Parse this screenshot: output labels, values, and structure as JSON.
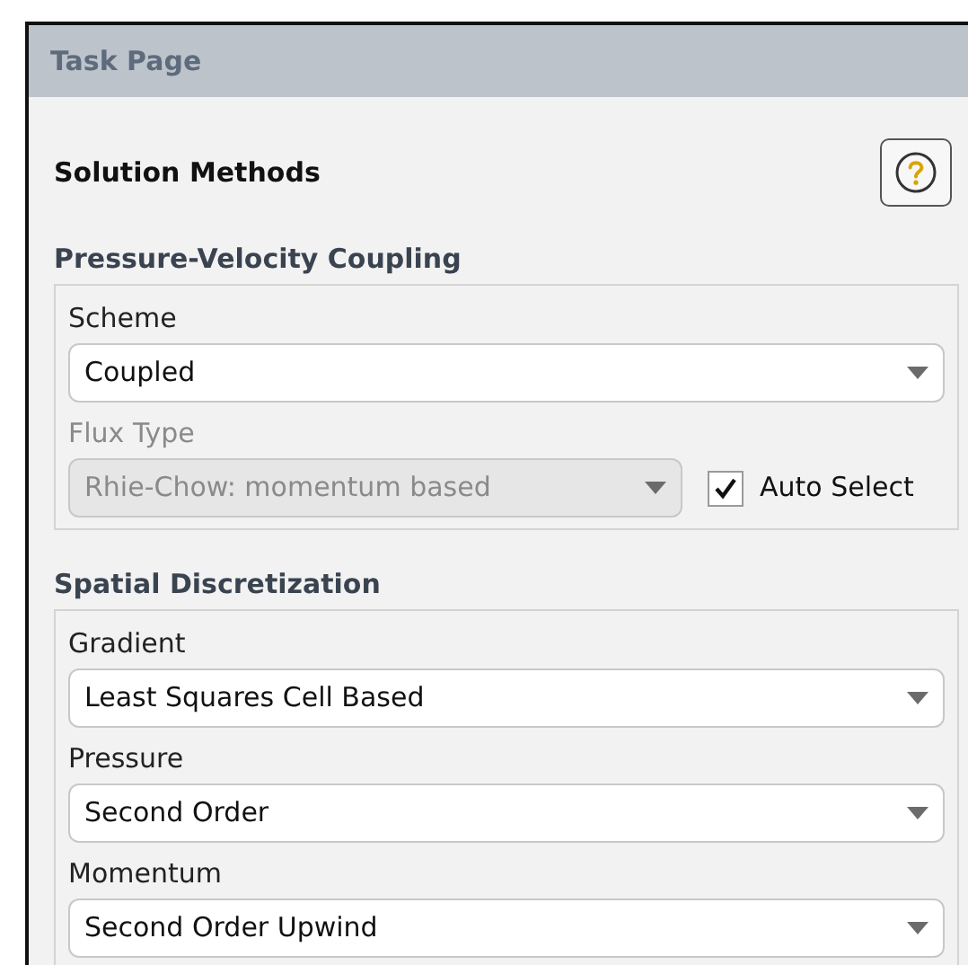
{
  "panel": {
    "title": "Task Page"
  },
  "heading": "Solution Methods",
  "sections": [
    {
      "title": "Pressure-Velocity Coupling",
      "fields": [
        {
          "label": "Scheme",
          "value": "Coupled",
          "disabled": false
        },
        {
          "label": "Flux Type",
          "value": "Rhie-Chow: momentum based",
          "disabled": true,
          "checkbox": {
            "label": "Auto Select",
            "checked": true
          }
        }
      ]
    },
    {
      "title": "Spatial Discretization",
      "fields": [
        {
          "label": "Gradient",
          "value": "Least Squares Cell Based",
          "disabled": false
        },
        {
          "label": "Pressure",
          "value": "Second Order",
          "disabled": false
        },
        {
          "label": "Momentum",
          "value": "Second Order Upwind",
          "disabled": false
        }
      ]
    }
  ]
}
